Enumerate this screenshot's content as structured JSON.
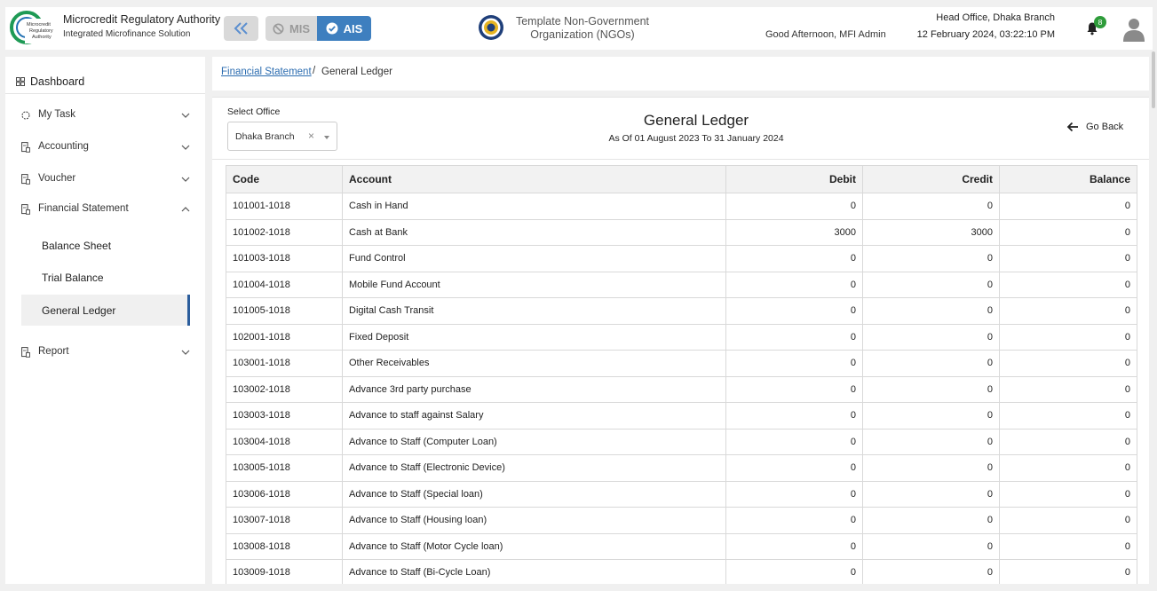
{
  "header": {
    "logo_text": "Microcredit Regulatory Authority",
    "org_name": "Microcredit Regulatory Authority",
    "org_subtitle": "Integrated Microfinance Solution",
    "mis_label": "MIS",
    "ais_label": "AIS",
    "tenant_name": "Template Non-Government Organization (NGOs)",
    "greeting": "Good Afternoon, MFI Admin",
    "branch": "Head Office, Dhaka Branch",
    "datetime": "12 February 2024, 03:22:10 PM",
    "notification_count": "8",
    "accent_color": "#3e7fbf"
  },
  "sidebar": {
    "dashboard": "Dashboard",
    "items": [
      {
        "label": "My Task",
        "icon": "loader-icon",
        "expanded": false
      },
      {
        "label": "Accounting",
        "icon": "ledger-icon",
        "expanded": false
      },
      {
        "label": "Voucher",
        "icon": "ledger-icon",
        "expanded": false
      },
      {
        "label": "Financial Statement",
        "icon": "ledger-icon",
        "expanded": true
      },
      {
        "label": "Report",
        "icon": "ledger-icon",
        "expanded": false
      }
    ],
    "sub_items": [
      {
        "label": "Balance Sheet"
      },
      {
        "label": "Trial Balance"
      },
      {
        "label": "General Ledger",
        "active": true
      }
    ]
  },
  "breadcrumb": {
    "parent": "Financial Statement",
    "separator": "/",
    "current": "General Ledger"
  },
  "report": {
    "select_office_label": "Select Office",
    "selected_office": "Dhaka Branch",
    "clear_symbol": "×",
    "title": "General Ledger",
    "subtitle": "As Of 01 August 2023 To 31 January 2024",
    "go_back": "Go Back",
    "columns": [
      "Code",
      "Account",
      "Debit",
      "Credit",
      "Balance"
    ],
    "rows": [
      {
        "code": "101001-1018",
        "account": "Cash in Hand",
        "debit": "0",
        "credit": "0",
        "balance": "0"
      },
      {
        "code": "101002-1018",
        "account": "Cash at Bank",
        "debit": "3000",
        "credit": "3000",
        "balance": "0"
      },
      {
        "code": "101003-1018",
        "account": "Fund Control",
        "debit": "0",
        "credit": "0",
        "balance": "0"
      },
      {
        "code": "101004-1018",
        "account": "Mobile Fund Account",
        "debit": "0",
        "credit": "0",
        "balance": "0"
      },
      {
        "code": "101005-1018",
        "account": "Digital Cash Transit",
        "debit": "0",
        "credit": "0",
        "balance": "0"
      },
      {
        "code": "102001-1018",
        "account": "Fixed Deposit",
        "debit": "0",
        "credit": "0",
        "balance": "0"
      },
      {
        "code": "103001-1018",
        "account": "Other Receivables",
        "debit": "0",
        "credit": "0",
        "balance": "0"
      },
      {
        "code": "103002-1018",
        "account": "Advance 3rd party purchase",
        "debit": "0",
        "credit": "0",
        "balance": "0"
      },
      {
        "code": "103003-1018",
        "account": "Advance to staff against Salary",
        "debit": "0",
        "credit": "0",
        "balance": "0"
      },
      {
        "code": "103004-1018",
        "account": "Advance to Staff (Computer Loan)",
        "debit": "0",
        "credit": "0",
        "balance": "0"
      },
      {
        "code": "103005-1018",
        "account": "Advance to Staff (Electronic Device)",
        "debit": "0",
        "credit": "0",
        "balance": "0"
      },
      {
        "code": "103006-1018",
        "account": "Advance to Staff (Special loan)",
        "debit": "0",
        "credit": "0",
        "balance": "0"
      },
      {
        "code": "103007-1018",
        "account": "Advance to Staff (Housing loan)",
        "debit": "0",
        "credit": "0",
        "balance": "0"
      },
      {
        "code": "103008-1018",
        "account": "Advance to Staff (Motor Cycle loan)",
        "debit": "0",
        "credit": "0",
        "balance": "0"
      },
      {
        "code": "103009-1018",
        "account": "Advance to Staff (Bi-Cycle Loan)",
        "debit": "0",
        "credit": "0",
        "balance": "0"
      }
    ]
  }
}
